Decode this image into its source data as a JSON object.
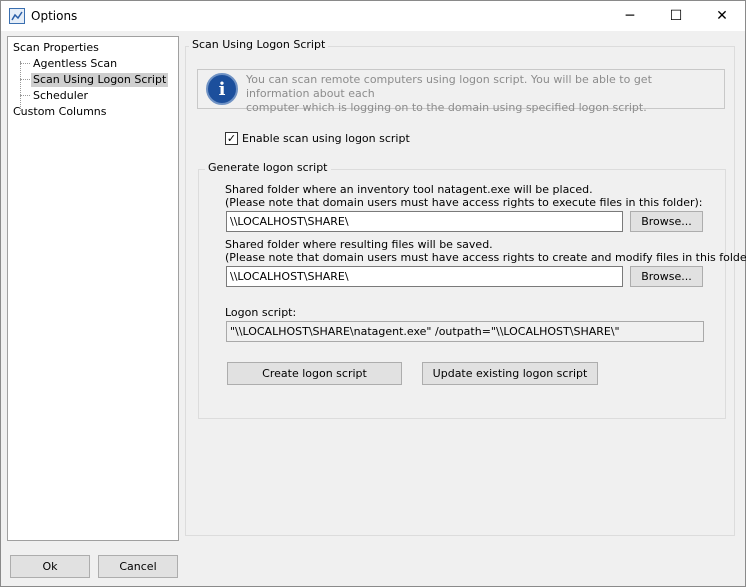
{
  "window": {
    "title": "Options"
  },
  "titlebar": {
    "minimize": "─",
    "maximize": "☐",
    "close": "✕"
  },
  "tree": {
    "items": [
      {
        "label": "Scan Properties"
      },
      {
        "label": "Agentless Scan"
      },
      {
        "label": "Scan Using Logon Script"
      },
      {
        "label": "Scheduler"
      },
      {
        "label": "Custom Columns"
      }
    ]
  },
  "section": {
    "title": "Scan Using Logon Script",
    "info_line1": "You can scan remote computers using logon script. You will be able to get information about each",
    "info_line2": "computer which is logging on to the domain using specified logon script.",
    "enable_label": "Enable scan using logon script",
    "enable_checked": true
  },
  "generate": {
    "title": "Generate logon script",
    "shared_label1": "Shared folder where an inventory tool natagent.exe will be placed.",
    "shared_note1": "(Please note that domain users must have access rights to execute files in this folder):",
    "shared_value1": "\\\\LOCALHOST\\SHARE\\",
    "browse1": "Browse...",
    "shared_label2": "Shared folder where resulting files will be saved.",
    "shared_note2": "(Please note that domain users must have access rights to create and modify files in this folder):",
    "shared_value2": "\\\\LOCALHOST\\SHARE\\",
    "browse2": "Browse...",
    "logon_label": "Logon script:",
    "logon_value": "\"\\\\LOCALHOST\\SHARE\\natagent.exe\" /outpath=\"\\\\LOCALHOST\\SHARE\\\"",
    "create_button": "Create logon script",
    "update_button": "Update existing logon script"
  },
  "footer": {
    "ok": "Ok",
    "cancel": "Cancel"
  }
}
